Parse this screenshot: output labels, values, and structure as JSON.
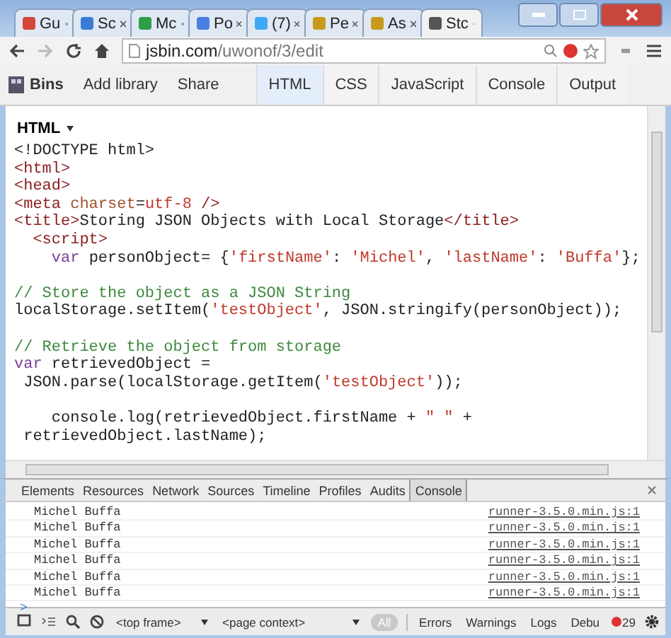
{
  "browser_tabs": [
    {
      "label": "Gu",
      "color": "#d44638",
      "selected": false
    },
    {
      "label": "Sc",
      "color": "#3b7bd4",
      "selected": false
    },
    {
      "label": "Mc",
      "color": "#2e9e48",
      "selected": false
    },
    {
      "label": "Po",
      "color": "#4a7fe0",
      "selected": false
    },
    {
      "label": "(7)",
      "color": "#3fa9f5",
      "selected": false
    },
    {
      "label": "Pe",
      "color": "#c89a1c",
      "selected": false
    },
    {
      "label": "As",
      "color": "#c89a1c",
      "selected": false
    },
    {
      "label": "Stc",
      "color": "#555555",
      "selected": true
    }
  ],
  "address_bar": {
    "host": "jsbin.com",
    "path": "/uwonof/3/edit"
  },
  "jsbin_toolbar": {
    "bins": "Bins",
    "links": [
      "Add library",
      "Share"
    ],
    "panels": [
      {
        "label": "HTML",
        "selected": true
      },
      {
        "label": "CSS",
        "selected": false
      },
      {
        "label": "JavaScript",
        "selected": false
      },
      {
        "label": "Console",
        "selected": false
      },
      {
        "label": "Output",
        "selected": false
      }
    ]
  },
  "editor": {
    "title": "HTML",
    "lines": [
      {
        "space_before": false,
        "tokens": [
          {
            "text": "<!DOCTYPE html>",
            "kind": "plain"
          }
        ]
      },
      {
        "space_before": false,
        "tokens": [
          {
            "text": "<html>",
            "kind": "tag"
          }
        ]
      },
      {
        "space_before": false,
        "tokens": [
          {
            "text": "<head>",
            "kind": "tag"
          }
        ]
      },
      {
        "space_before": false,
        "tokens": [
          {
            "text": "<meta ",
            "kind": "tag"
          },
          {
            "text": "charset",
            "kind": "attr"
          },
          {
            "text": "=",
            "kind": "plain"
          },
          {
            "text": "utf-8",
            "kind": "string"
          },
          {
            "text": " />",
            "kind": "tag"
          }
        ]
      },
      {
        "space_before": false,
        "tokens": [
          {
            "text": "<title>",
            "kind": "tag"
          },
          {
            "text": "Storing JSON Objects with Local Storage",
            "kind": "plain"
          },
          {
            "text": "</title>",
            "kind": "tag"
          }
        ]
      },
      {
        "space_before": false,
        "tokens": [
          {
            "text": "  <script>",
            "kind": "tag"
          }
        ]
      },
      {
        "space_before": false,
        "tokens": [
          {
            "text": "    var",
            "kind": "keyword"
          },
          {
            "text": " personObject= {",
            "kind": "plain"
          },
          {
            "text": "'firstName'",
            "kind": "string"
          },
          {
            "text": ": ",
            "kind": "plain"
          },
          {
            "text": "'Michel'",
            "kind": "string"
          },
          {
            "text": ", ",
            "kind": "plain"
          },
          {
            "text": "'lastName'",
            "kind": "string"
          },
          {
            "text": ": ",
            "kind": "plain"
          },
          {
            "text": "'Buffa'",
            "kind": "string"
          },
          {
            "text": "};",
            "kind": "plain"
          }
        ]
      },
      {
        "space_before": true,
        "tokens": [
          {
            "text": "// Store the object as a JSON String",
            "kind": "comment"
          }
        ]
      },
      {
        "space_before": false,
        "tokens": [
          {
            "text": "localStorage.setItem(",
            "kind": "plain"
          },
          {
            "text": "'testObject'",
            "kind": "string"
          },
          {
            "text": ", JSON.stringify(personObject));",
            "kind": "plain"
          }
        ]
      },
      {
        "space_before": true,
        "tokens": [
          {
            "text": "// Retrieve the object from storage",
            "kind": "comment"
          }
        ]
      },
      {
        "space_before": false,
        "tokens": [
          {
            "text": "var",
            "kind": "keyword"
          },
          {
            "text": " retrievedObject =",
            "kind": "plain"
          }
        ]
      },
      {
        "space_before": false,
        "tokens": [
          {
            "text": " JSON.parse(localStorage.getItem(",
            "kind": "plain"
          },
          {
            "text": "'testObject'",
            "kind": "string"
          },
          {
            "text": "));",
            "kind": "plain"
          }
        ]
      },
      {
        "space_before": true,
        "tokens": [
          {
            "text": "    console.log(retrievedObject.firstName + ",
            "kind": "plain"
          },
          {
            "text": "\" \"",
            "kind": "string"
          },
          {
            "text": " +",
            "kind": "plain"
          }
        ]
      },
      {
        "space_before": false,
        "tokens": [
          {
            "text": " retrievedObject.lastName);",
            "kind": "plain"
          }
        ]
      }
    ]
  },
  "devtools": {
    "tabs": [
      {
        "label": "Elements",
        "selected": false
      },
      {
        "label": "Resources",
        "selected": false
      },
      {
        "label": "Network",
        "selected": false
      },
      {
        "label": "Sources",
        "selected": false
      },
      {
        "label": "Timeline",
        "selected": false
      },
      {
        "label": "Profiles",
        "selected": false
      },
      {
        "label": "Audits",
        "selected": false
      },
      {
        "label": "Console",
        "selected": true
      }
    ],
    "messages": [
      {
        "text": "Michel Buffa",
        "source": "runner-3.5.0.min.js:1"
      },
      {
        "text": "Michel Buffa",
        "source": "runner-3.5.0.min.js:1"
      },
      {
        "text": "Michel Buffa",
        "source": "runner-3.5.0.min.js:1"
      },
      {
        "text": "Michel Buffa",
        "source": "runner-3.5.0.min.js:1"
      },
      {
        "text": "Michel Buffa",
        "source": "runner-3.5.0.min.js:1"
      },
      {
        "text": "Michel Buffa",
        "source": "runner-3.5.0.min.js:1"
      }
    ],
    "prompt": ">",
    "frame_select": "<top frame>",
    "context_select": "<page context>",
    "filters": [
      {
        "label": "All",
        "selected": true
      },
      {
        "label": "Errors",
        "selected": false
      },
      {
        "label": "Warnings",
        "selected": false
      },
      {
        "label": "Logs",
        "selected": false
      },
      {
        "label": "Debu",
        "selected": false
      }
    ],
    "error_count": "29"
  }
}
